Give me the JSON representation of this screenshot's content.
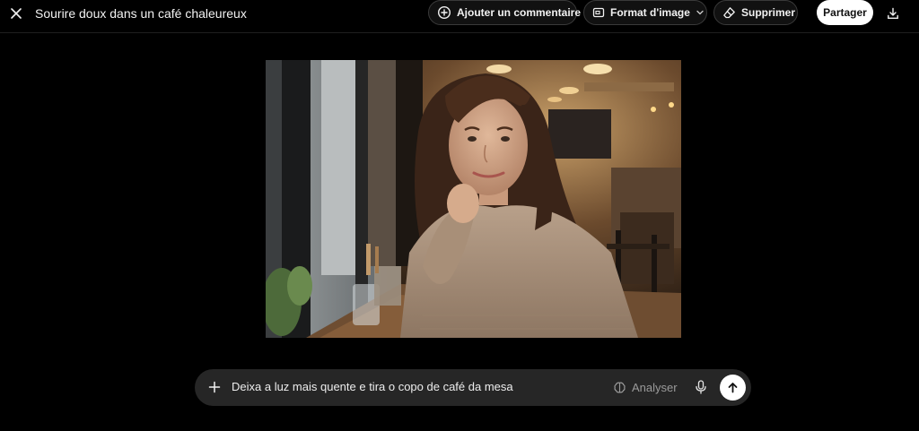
{
  "header": {
    "title": "Sourire doux dans un café chaleureux",
    "close_icon": "close-icon",
    "actions": {
      "comment_label": "Ajouter un commentaire",
      "format_label": "Format d'image",
      "delete_label": "Supprimer",
      "share_label": "Partager"
    },
    "icons": {
      "comment": "comment-plus-icon",
      "format": "aspect-ratio-icon",
      "chevron": "chevron-down-icon",
      "delete": "eraser-icon",
      "download": "download-icon"
    }
  },
  "image": {
    "alt": "Woman in a beige knit sweater smiling at a wooden table by a café window"
  },
  "composer": {
    "value": "Deixa a luz mais quente e tira o copo de café da mesa",
    "analyse_label": "Analyser",
    "icons": {
      "add": "plus-icon",
      "analyse": "brain-icon",
      "mic": "microphone-icon",
      "send": "arrow-up-icon"
    }
  },
  "colors": {
    "background": "#000000",
    "pill_border": "#3a3a3a",
    "composer_bg": "#262626",
    "share_bg": "#ffffff"
  }
}
